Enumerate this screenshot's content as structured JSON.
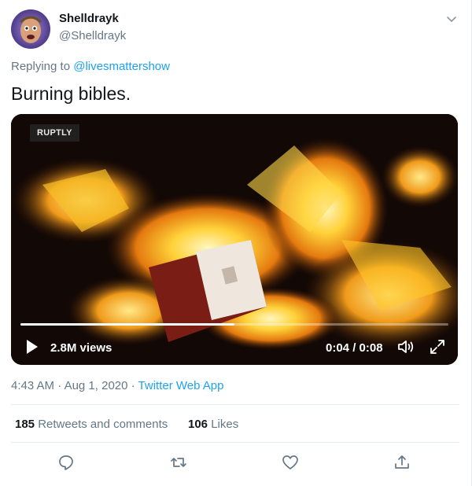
{
  "author": {
    "display_name": "Shelldrayk",
    "handle": "@Shelldrayk",
    "avatar_icon": "avatar-face-icon"
  },
  "reply": {
    "prefix": "Replying to",
    "target": "@livesmattershow"
  },
  "tweet": {
    "text": "Burning bibles."
  },
  "video": {
    "badge": "RUPTLY",
    "views": "2.8M views",
    "time": "0:04 / 0:08",
    "progress_fraction": 0.5
  },
  "meta": {
    "time": "4:43 AM",
    "sep1": "·",
    "date": "Aug 1, 2020",
    "sep2": "·",
    "app": "Twitter Web App"
  },
  "stats": {
    "retweets_count": "185",
    "retweets_label": "Retweets and comments",
    "likes_count": "106",
    "likes_label": "Likes"
  },
  "colors": {
    "link": "#1da1f2",
    "muted": "#657786",
    "text": "#14171a",
    "divider": "#e6ecf0"
  },
  "icons": [
    "chevron-down-icon",
    "play-icon",
    "volume-icon",
    "fullscreen-icon",
    "reply-icon",
    "retweet-icon",
    "like-icon",
    "share-icon"
  ]
}
